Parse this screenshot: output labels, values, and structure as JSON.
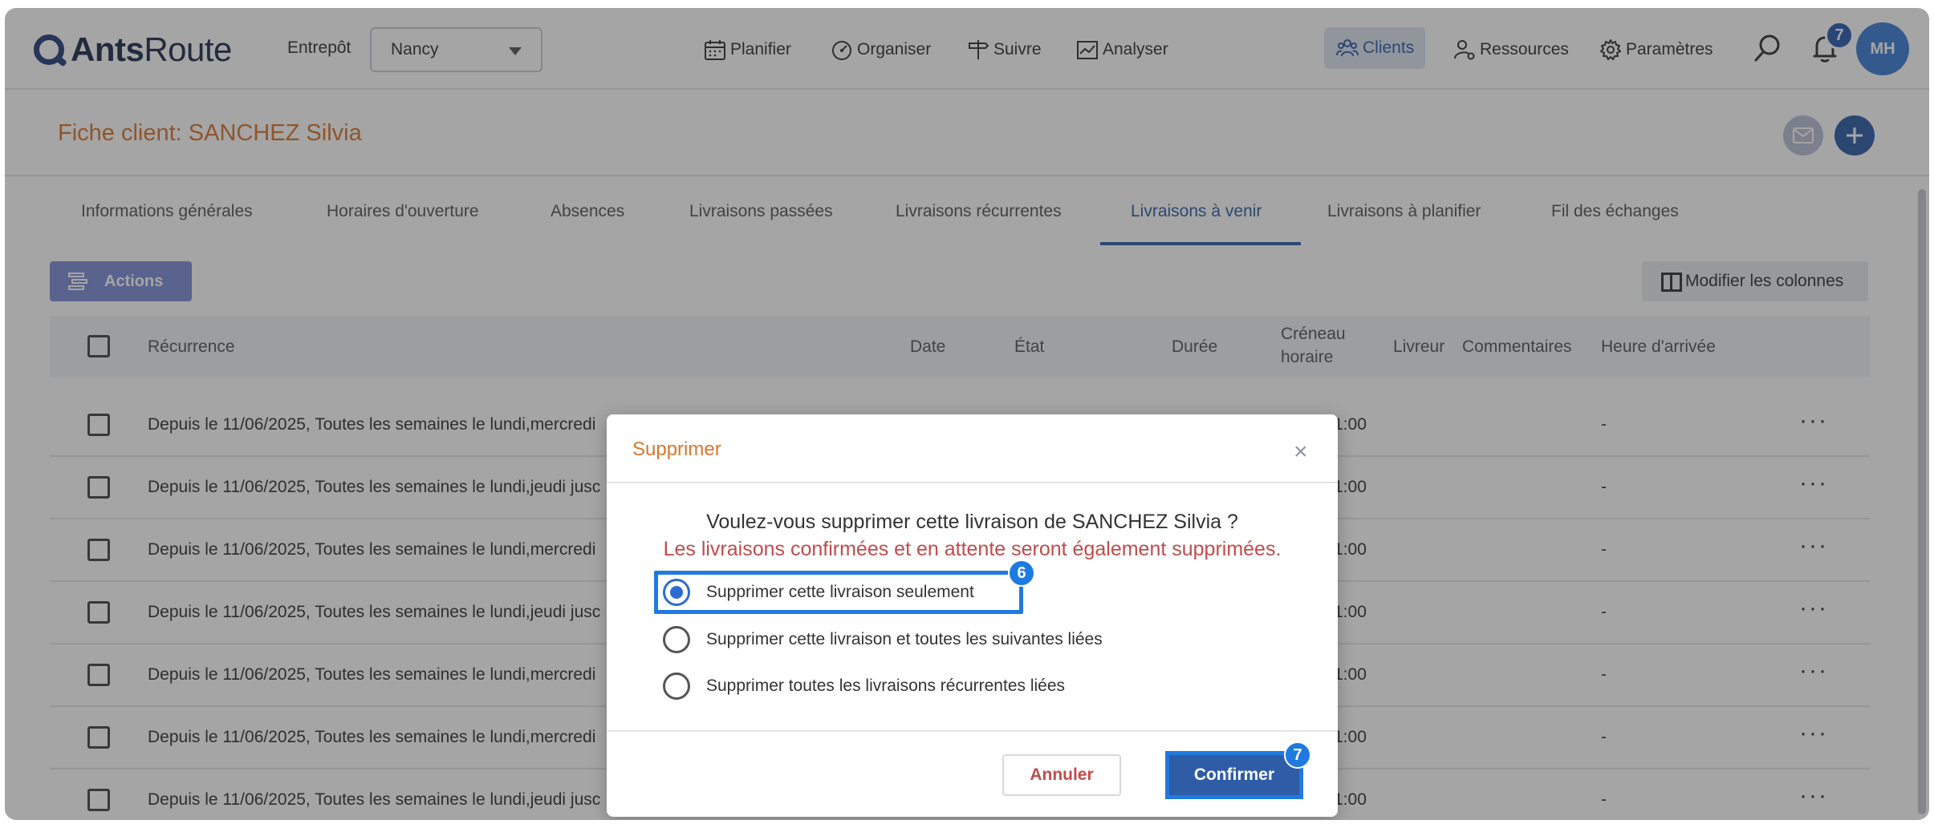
{
  "app": {
    "logo_bold": "Ants",
    "logo_light": "Route",
    "warehouse_label": "Entrepôt",
    "warehouse_value": "Nancy"
  },
  "nav": {
    "planifier": "Planifier",
    "organiser": "Organiser",
    "suivre": "Suivre",
    "analyser": "Analyser",
    "clients": "Clients",
    "ressources": "Ressources",
    "parametres": "Paramètres",
    "notification_count": "7",
    "avatar_initials": "MH"
  },
  "header": {
    "title": "Fiche client: SANCHEZ Silvia"
  },
  "tabs": [
    {
      "label": "Informations générales"
    },
    {
      "label": "Horaires d'ouverture"
    },
    {
      "label": "Absences"
    },
    {
      "label": "Livraisons passées"
    },
    {
      "label": "Livraisons récurrentes"
    },
    {
      "label": "Livraisons à venir"
    },
    {
      "label": "Livraisons à planifier"
    },
    {
      "label": "Fil des échanges"
    }
  ],
  "toolbar": {
    "actions_label": "Actions",
    "columns_label": "Modifier les colonnes"
  },
  "table": {
    "headers": {
      "recurrence": "Récurrence",
      "date": "Date",
      "etat": "État",
      "duree": "Durée",
      "creneau_line1": "Créneau",
      "creneau_line2": "horaire",
      "livreur": "Livreur",
      "commentaires": "Commentaires",
      "heure_arrivee": "Heure d'arrivée"
    },
    "rows": [
      {
        "recurrence": "Depuis le 11/06/2025, Toutes les semaines le lundi,mercredi",
        "creneau": "1:00",
        "heure": "-"
      },
      {
        "recurrence": "Depuis le 11/06/2025, Toutes les semaines le lundi,jeudi jusc",
        "creneau": "1:00",
        "heure": "-"
      },
      {
        "recurrence": "Depuis le 11/06/2025, Toutes les semaines le lundi,mercredi",
        "creneau": "1:00",
        "heure": "-"
      },
      {
        "recurrence": "Depuis le 11/06/2025, Toutes les semaines le lundi,jeudi jusc",
        "creneau": "1:00",
        "heure": "-"
      },
      {
        "recurrence": "Depuis le 11/06/2025, Toutes les semaines le lundi,mercredi",
        "creneau": "1:00",
        "heure": "-"
      },
      {
        "recurrence": "Depuis le 11/06/2025, Toutes les semaines le lundi,mercredi",
        "creneau": "1:00",
        "heure": "-"
      },
      {
        "recurrence": "Depuis le 11/06/2025, Toutes les semaines le lundi,jeudi jusc",
        "creneau": "1:00",
        "heure": "-"
      }
    ],
    "row_menu": "···"
  },
  "modal": {
    "title": "Supprimer",
    "close": "×",
    "question": "Voulez-vous supprimer cette livraison de SANCHEZ Silvia ?",
    "warning": "Les livraisons confirmées et en attente seront également supprimées.",
    "options": [
      {
        "label": "Supprimer cette livraison seulement",
        "checked": true
      },
      {
        "label": "Supprimer cette livraison et toutes les suivantes liées",
        "checked": false
      },
      {
        "label": "Supprimer toutes les livraisons récurrentes liées",
        "checked": false
      }
    ],
    "cancel_label": "Annuler",
    "confirm_label": "Confirmer",
    "step_option": "6",
    "step_confirm": "7"
  },
  "colors": {
    "accent": "#2e5da8",
    "title_orange": "#d9762f",
    "warning_red": "#c24b4b",
    "highlight_blue": "#1f7ae0"
  }
}
